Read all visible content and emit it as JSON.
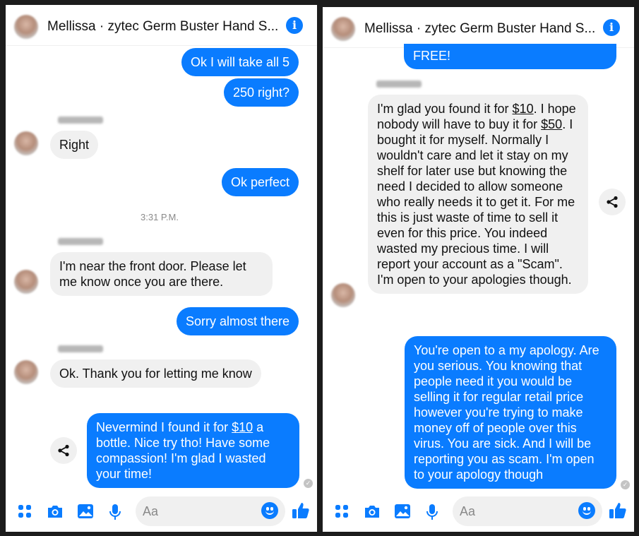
{
  "left": {
    "header": {
      "title": "Mellissa · zytec Germ Buster Hand S..."
    },
    "messages": {
      "m1": "Ok I will take all 5",
      "m2": "250 right?",
      "m3": "Right",
      "m4": "Ok perfect",
      "time": "3:31 P.M.",
      "m5": "I'm near the front door. Please let me know once you are there.",
      "m6": "Sorry almost there",
      "m7": "Ok. Thank you for letting me know",
      "m8": {
        "a": "Nevermind I found it for ",
        "b": "$10",
        "c": " a bottle. Nice try tho! Have some compassion! I'm glad I wasted your time!"
      }
    },
    "composer": {
      "placeholder": "Aa"
    }
  },
  "right": {
    "header": {
      "title": "Mellissa · zytec Germ Buster Hand S..."
    },
    "messages": {
      "m0": "FREE!",
      "m1": {
        "a": "I'm glad you found it for ",
        "b": "$10",
        "c": ". I hope nobody will have to buy it for ",
        "d": "$50",
        "e": ". I bought it for myself. Normally I wouldn't care and let it stay on my shelf for later use but knowing the need I decided to allow someone who really needs it to get it. For me this is just waste of time to sell it even for this price. You indeed wasted my precious time. I will report your account as a \"Scam\". I'm open to your apologies though."
      },
      "m2": "You're open to a my apology. Are you serious. You knowing that people need it you would be selling it for regular retail price however you're trying to make money off of people over this virus. You are sick. And I will be reporting you as scam. I'm open to your apology though"
    },
    "composer": {
      "placeholder": "Aa"
    }
  },
  "colors": {
    "accent": "#0a7cff",
    "incoming_bubble": "#f0f0f0"
  },
  "icons": [
    "info-icon",
    "share-icon",
    "more-dots-icon",
    "camera-icon",
    "image-icon",
    "microphone-icon",
    "emoji-icon",
    "thumbs-up-icon"
  ]
}
